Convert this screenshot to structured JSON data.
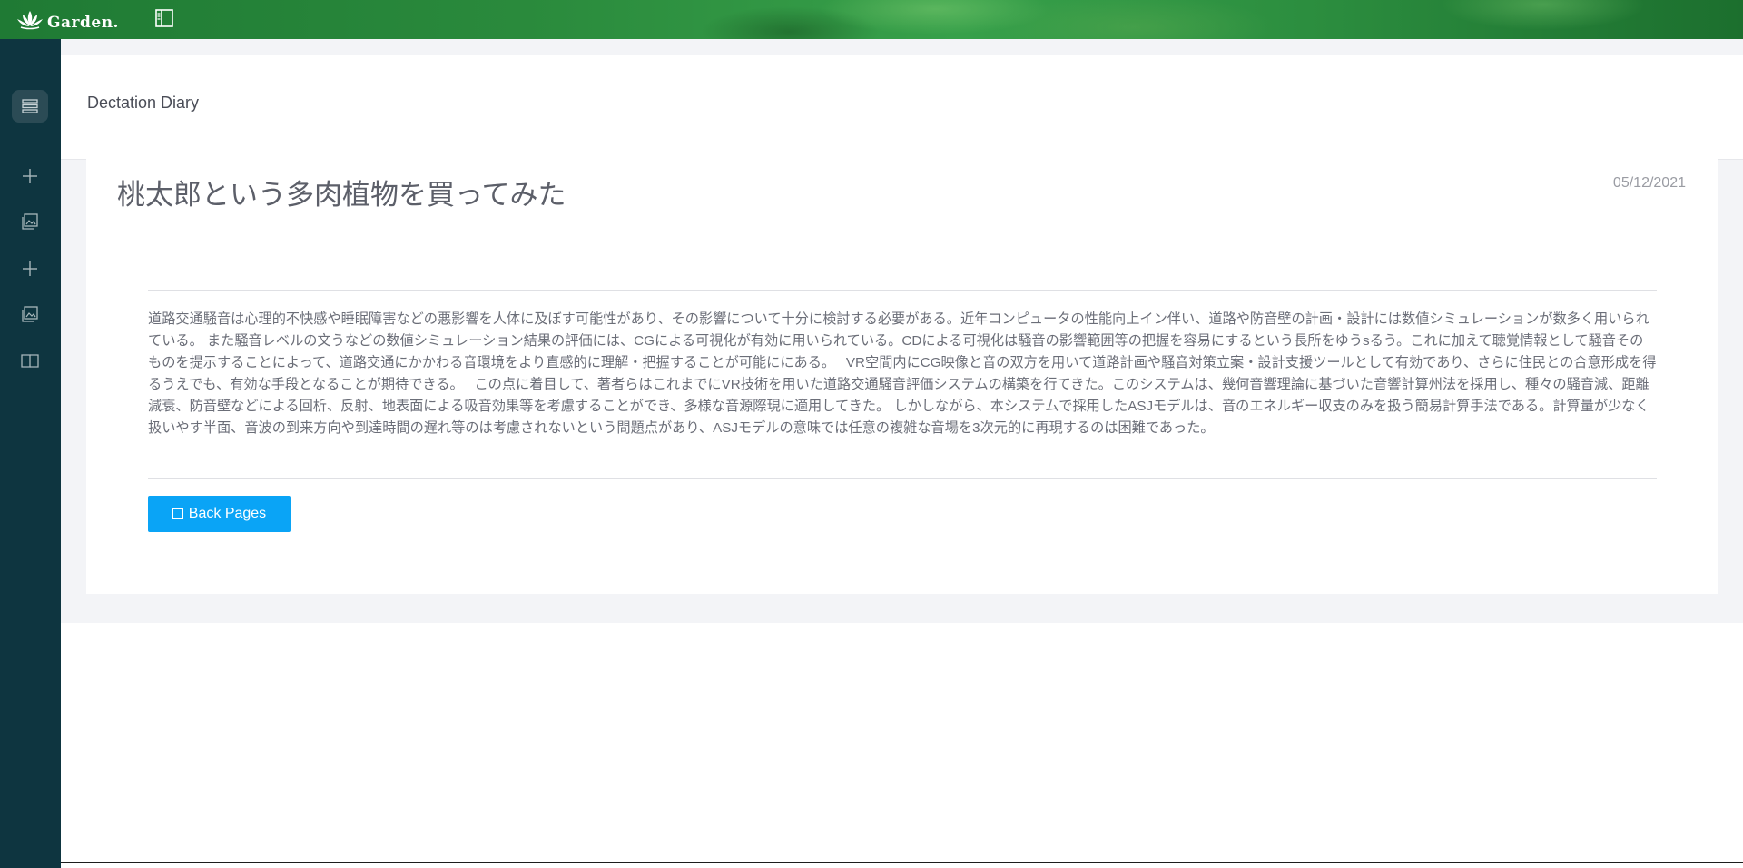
{
  "brand": {
    "name": "Garden.",
    "logo_icon": "lotus-icon"
  },
  "topbar": {
    "toggle_icon": "sidebar-toggle-icon"
  },
  "sidebar": {
    "items": [
      {
        "icon": "list-icon",
        "active": true
      },
      {
        "icon": "plus-icon",
        "active": false
      },
      {
        "icon": "image-icon",
        "active": false
      },
      {
        "icon": "plus-icon",
        "active": false
      },
      {
        "icon": "image-icon",
        "active": false
      },
      {
        "icon": "book-icon",
        "active": false
      }
    ]
  },
  "page": {
    "title": "Dectation Diary"
  },
  "post": {
    "title": "桃太郎という多肉植物を買ってみた",
    "date": "05/12/2021",
    "body": "道路交通騒音は心理的不快感や睡眠障害などの悪影響を人体に及ぼす可能性があり、その影響について十分に検討する必要がある。近年コンピュータの性能向上イン伴い、道路や防音壁の計画・設計には数値シミュレーションが数多く用いられている。 また騒音レベルの文うなどの数値シミュレーション結果の評価には、CGによる可視化が有効に用いられている。CDによる可視化は騒音の影響範囲等の把握を容易にするという長所をゆうsるう。これに加えて聴覚情報として騒音そのものを提示することによって、道路交通にかかわる音環境をより直感的に理解・把握することが可能ににある。　 VR空間内にCG映像と音の双方を用いて道路計画や騒音対策立案・設計支援ツールとして有効であり、さらに住民との合意形成を得るうえでも、有効な手段となることが期待できる。　 この点に着目して、著者らはこれまでにVR技術を用いた道路交通騒音評価システムの構築を行てきた。このシステムは、幾何音響理論に基づいた音響計算州法を採用し、種々の騒音減、距離減衰、防音壁などによる回析、反射、地表面による吸音効果等を考慮することができ、多様な音源際現に適用してきた。 しかしながら、本システムで採用したASJモデルは、音のエネルギー収支のみを扱う簡易計算手法である。計算量が少なく扱いやす半面、音波の到来方向や到達時間の遅れ等のは考慮されないという問題点があり、ASJモデルの意味では任意の複雑な音場を3次元的に再現するのは困難であった。",
    "back_button_label": "Back Pages"
  },
  "colors": {
    "sidebar_bg": "#0e3540",
    "button_bg": "#0aa4f6",
    "main_bg": "#f3f4f7"
  }
}
